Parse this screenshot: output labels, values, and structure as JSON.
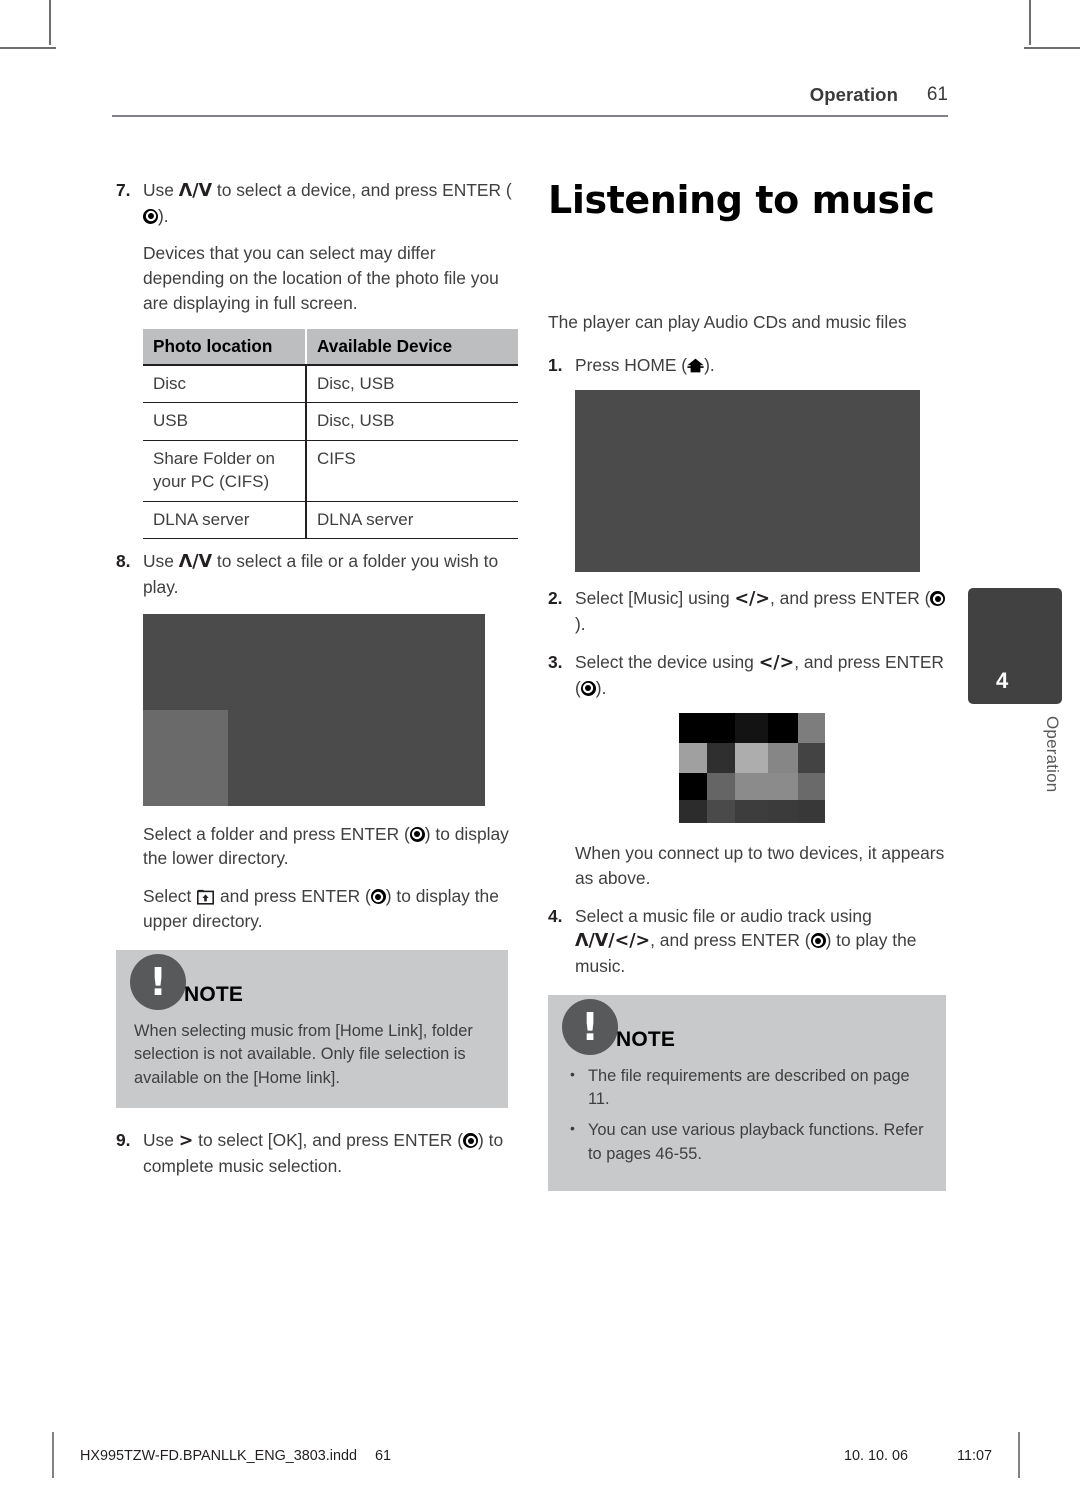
{
  "header": {
    "section": "Operation",
    "page_number": "61"
  },
  "left_column": {
    "step7": {
      "num": "7.",
      "text_before": "Use ",
      "keys": "Λ/V",
      "text_after": " to select a device, and press ENTER (",
      "text_end": ")."
    },
    "step7_note": "Devices that you can select may differ depending on the location of the photo file you are displaying in full screen.",
    "table": {
      "headers": [
        "Photo location",
        "Available Device"
      ],
      "rows": [
        [
          "Disc",
          "Disc, USB"
        ],
        [
          "USB",
          "Disc, USB"
        ],
        [
          "Share Folder on your PC (CIFS)",
          "CIFS"
        ],
        [
          "DLNA server",
          "DLNA server"
        ]
      ]
    },
    "step8": {
      "num": "8.",
      "text_before": "Use ",
      "keys": "Λ/V",
      "text_after": " to select a file or a folder you wish to play."
    },
    "after_shot_para1_a": "Select a folder and press ENTER (",
    "after_shot_para1_b": ") to display the lower directory.",
    "after_shot_para2_a": "Select ",
    "after_shot_para2_b": " and press ENTER (",
    "after_shot_para2_c": ") to display the upper directory.",
    "note": {
      "badge": "!",
      "title": "NOTE",
      "text": "When selecting music from [Home Link], folder selection is not available. Only file selection is available on the [Home link]."
    },
    "step9": {
      "num": "9.",
      "text_before": "Use ",
      "keys": ">",
      "text_after": " to select [OK], and press ENTER (",
      "text_end": ") to complete music selection."
    }
  },
  "right_column": {
    "title": "Listening to music",
    "intro": "The player can play Audio CDs and music files",
    "step1": {
      "num": "1.",
      "text_before": "Press HOME (",
      "text_end": ")."
    },
    "step2": {
      "num": "2.",
      "text_before": "Select [Music] using ",
      "keys": "</>",
      "text_after": ", and press ENTER (",
      "text_end": ")."
    },
    "step3": {
      "num": "3.",
      "text_before": "Select the device using ",
      "keys": "</>",
      "text_after": ", and press ENTER (",
      "text_end": ")."
    },
    "after_pixel_note": "When you connect up to two devices, it appears as above.",
    "step4": {
      "num": "4.",
      "text_before": "Select a music file or audio track using ",
      "keys": "Λ/V/</>",
      "text_after": ", and press ENTER (",
      "text_end": ") to play the music."
    },
    "note": {
      "badge": "!",
      "title": "NOTE",
      "items": [
        "The file requirements are described on page 11.",
        "You can use various playback functions. Refer to pages 46-55."
      ]
    }
  },
  "side_tab": {
    "number": "4",
    "label": "Operation"
  },
  "footer": {
    "file": "HX995TZW-FD.BPANLLK_ENG_3803.indd",
    "page": "61",
    "date": "10. 10. 06",
    "time": "11:07"
  },
  "colors": {
    "header_rule": "#808285",
    "table_header_bg": "#bcbec0",
    "note_bg": "#c8c9ca",
    "note_badge": "#58595b",
    "screenshot_placeholder": "#4b4b4b",
    "screenshot_inner": "#6a6a6a",
    "side_tab_bg": "#414141"
  },
  "pixel_image": {
    "cols": 5,
    "rows": 4,
    "cells": [
      "#000000",
      "#000000",
      "#131313",
      "#000000",
      "#7d7d7d",
      "#a0a0a0",
      "#2f2f2f",
      "#adadad",
      "#868686",
      "#434343",
      "#000000",
      "#656565",
      "#8b8b8b",
      "#8b8b8b",
      "#6a6a6a",
      "#2c2c2c",
      "#4a4a4a",
      "#3d3d3d",
      "#3b3b3b",
      "#383838"
    ]
  }
}
